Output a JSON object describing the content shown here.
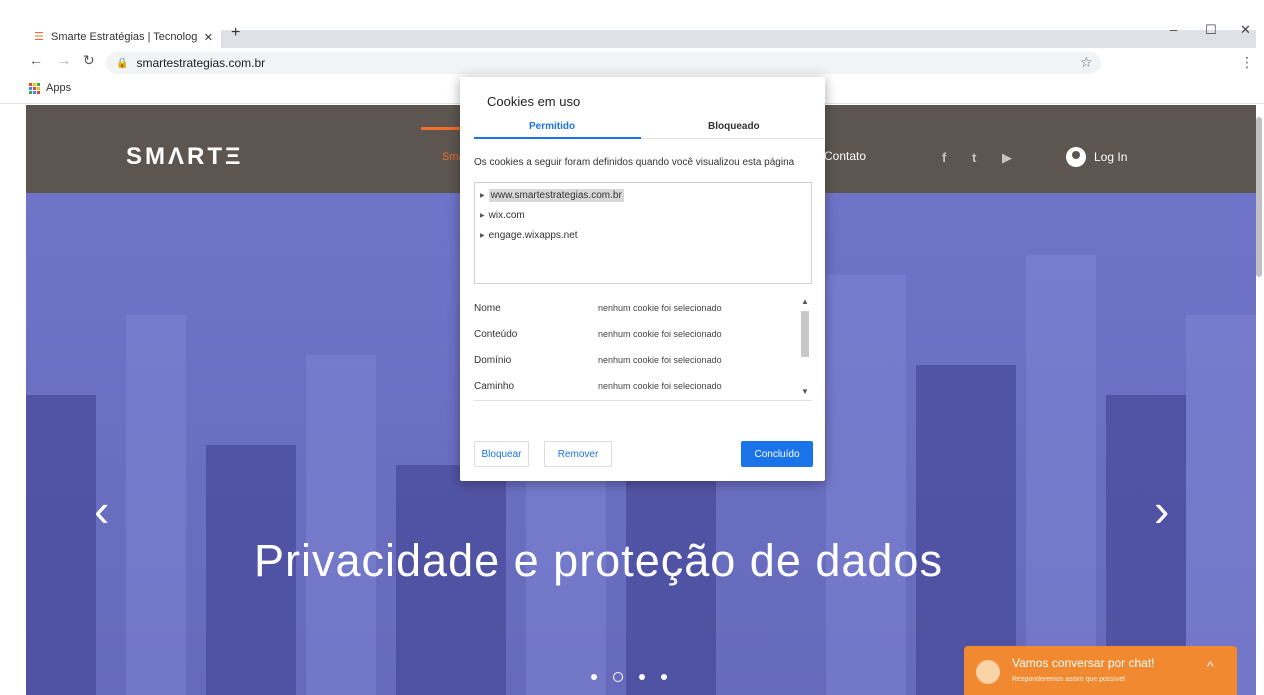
{
  "browser": {
    "tab_title": "Smarte Estratégias | Tecnologia |",
    "tab_close": "✕",
    "new_tab": "+",
    "url": "smartestrategias.com.br",
    "bookmarks": [
      {
        "label": "Apps"
      }
    ],
    "window_controls": [
      "–",
      "☐",
      "✕"
    ]
  },
  "site": {
    "logo": "SMΛRTΞ",
    "nav_fragment": "Sma",
    "nav_contato": "Contato",
    "social": [
      "f",
      "t",
      "▶"
    ],
    "login": "Log In",
    "hero_title": "Privacidade e proteção de dados",
    "prev": "‹",
    "next": "›",
    "slides": 4,
    "active_slide": 1,
    "chat_title": "Vamos conversar por chat!",
    "chat_sub": "Responderemos assim que possível",
    "chat_chevron": "^",
    "colors": {
      "header": "#5d5650",
      "accent": "#f26c2a",
      "hero": "#5c62c0",
      "chat": "#f0892f"
    }
  },
  "dialog": {
    "title": "Cookies em uso",
    "tabs": [
      {
        "label": "Permitido",
        "active": true
      },
      {
        "label": "Bloqueado",
        "active": false
      }
    ],
    "description": "Os cookies a seguir foram definidos quando você visualizou esta página",
    "domains": [
      {
        "label": "www.smartestrategias.com.br",
        "selected": true
      },
      {
        "label": "wix.com",
        "selected": false
      },
      {
        "label": "engage.wixapps.net",
        "selected": false
      }
    ],
    "details": [
      {
        "key": "Nome",
        "value": "nenhum cookie foi selecionado"
      },
      {
        "key": "Conteúdo",
        "value": "nenhum cookie foi selecionado"
      },
      {
        "key": "Domínio",
        "value": "nenhum cookie foi selecionado"
      },
      {
        "key": "Caminho",
        "value": "nenhum cookie foi selecionado"
      }
    ],
    "buttons": {
      "block": "Bloquear",
      "remove": "Remover",
      "done": "Concluído"
    }
  }
}
